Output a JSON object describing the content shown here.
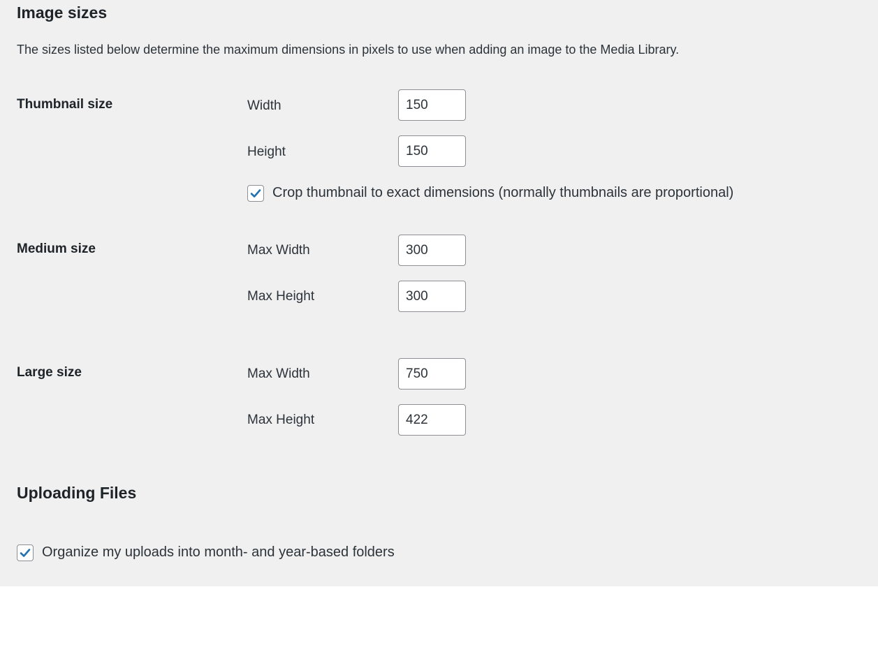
{
  "image_sizes": {
    "title": "Image sizes",
    "description": "The sizes listed below determine the maximum dimensions in pixels to use when adding an image to the Media Library."
  },
  "thumbnail": {
    "label": "Thumbnail size",
    "width_label": "Width",
    "width_value": "150",
    "height_label": "Height",
    "height_value": "150",
    "crop_label": "Crop thumbnail to exact dimensions (normally thumbnails are proportional)",
    "crop_checked": true
  },
  "medium": {
    "label": "Medium size",
    "width_label": "Max Width",
    "width_value": "300",
    "height_label": "Max Height",
    "height_value": "300"
  },
  "large": {
    "label": "Large size",
    "width_label": "Max Width",
    "width_value": "750",
    "height_label": "Max Height",
    "height_value": "422"
  },
  "uploading": {
    "title": "Uploading Files",
    "organize_label": "Organize my uploads into month- and year-based folders",
    "organize_checked": true
  },
  "colors": {
    "panel_background": "#f0f0f1",
    "check_mark": "#2271b1",
    "input_border": "#8c8f94"
  },
  "icons": {
    "checkbox_check": "check-icon"
  }
}
